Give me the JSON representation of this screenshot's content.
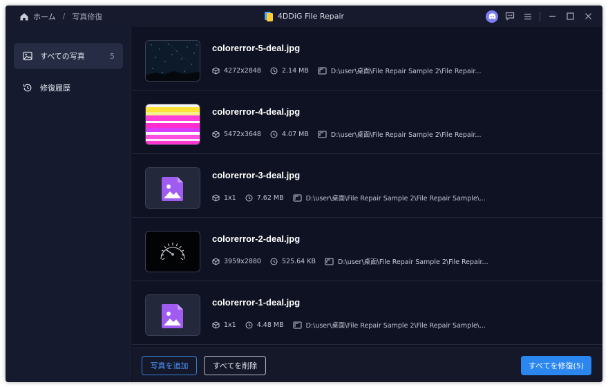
{
  "titlebar": {
    "home_label": "ホーム",
    "separator": "/",
    "current_page": "写真修復",
    "app_title": "4DDiG File Repair"
  },
  "sidebar": {
    "items": [
      {
        "label": "すべての写真",
        "count": "5",
        "icon": "image-icon",
        "active": true
      },
      {
        "label": "修復履歴",
        "count": "",
        "icon": "history-icon",
        "active": false
      }
    ]
  },
  "files": [
    {
      "name": "colorerror-5-deal.jpg",
      "resolution": "4272x2848",
      "size": "2.14 MB",
      "path": "D:\\user\\桌面\\File Repair Sample 2\\File Repair...",
      "thumb": "night-sky"
    },
    {
      "name": "colorerror-4-deal.jpg",
      "resolution": "5472x3648",
      "size": "4.07 MB",
      "path": "D:\\user\\桌面\\File Repair Sample 2\\File Repair...",
      "thumb": "color-glitch"
    },
    {
      "name": "colorerror-3-deal.jpg",
      "resolution": "1x1",
      "size": "7.62 MB",
      "path": "D:\\user\\桌面\\File Repair Sample 2\\File Repair Sample\\...",
      "thumb": "placeholder"
    },
    {
      "name": "colorerror-2-deal.jpg",
      "resolution": "3959x2880",
      "size": "525.64 KB",
      "path": "D:\\user\\桌面\\File Repair Sample 2\\File Repair...",
      "thumb": "speedometer"
    },
    {
      "name": "colorerror-1-deal.jpg",
      "resolution": "1x1",
      "size": "4.48 MB",
      "path": "D:\\user\\桌面\\File Repair Sample 2\\File Repair Sample\\...",
      "thumb": "placeholder"
    }
  ],
  "footer": {
    "add_label": "写真を追加",
    "delete_label": "すべてを削除",
    "repair_label": "すべてを修復(5)"
  },
  "colors": {
    "accent": "#2b86f0",
    "background": "#0f1222",
    "sidebar": "#151a2e",
    "placeholder_icon": "#a05cf0"
  }
}
